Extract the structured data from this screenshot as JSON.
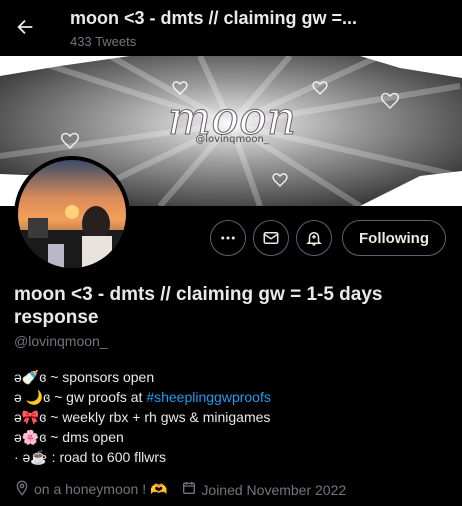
{
  "header": {
    "title": "moon <3 - dmts // claiming gw =...",
    "tweet_count": "433 Tweets"
  },
  "banner": {
    "logo_text": "moon",
    "logo_subtext": "@lovinqmoon_"
  },
  "actions": {
    "more_icon": "more-icon",
    "message_icon": "mail-icon",
    "notify_icon": "notification-bell-icon",
    "follow_label": "Following"
  },
  "profile": {
    "display_name": "moon <3 - dmts // claiming gw = 1-5 days response",
    "handle": "@lovinqmoon_"
  },
  "bio": {
    "lines": [
      {
        "prefix": "ə🍼ɞ ~",
        "text": " sponsors open"
      },
      {
        "prefix": "ə 🌙ɞ ~",
        "text": " gw proofs at ",
        "hashtag": "#sheeplinggwproofs"
      },
      {
        "prefix": "ə🎀ɞ ~",
        "text": " weekly rbx + rh gws & minigames"
      },
      {
        "prefix": "ə🌸ɞ ~",
        "text": " dms open"
      },
      {
        "prefix": " · ə☕ :",
        "text": " road to 600 fllwrs"
      }
    ]
  },
  "meta": {
    "location": "on a honeymoon ! 🫶",
    "joined": "Joined November 2022"
  },
  "colors": {
    "background": "#000000",
    "text": "#e7e9ea",
    "muted": "#71767b",
    "link": "#1d9bf0",
    "border": "#536471"
  }
}
